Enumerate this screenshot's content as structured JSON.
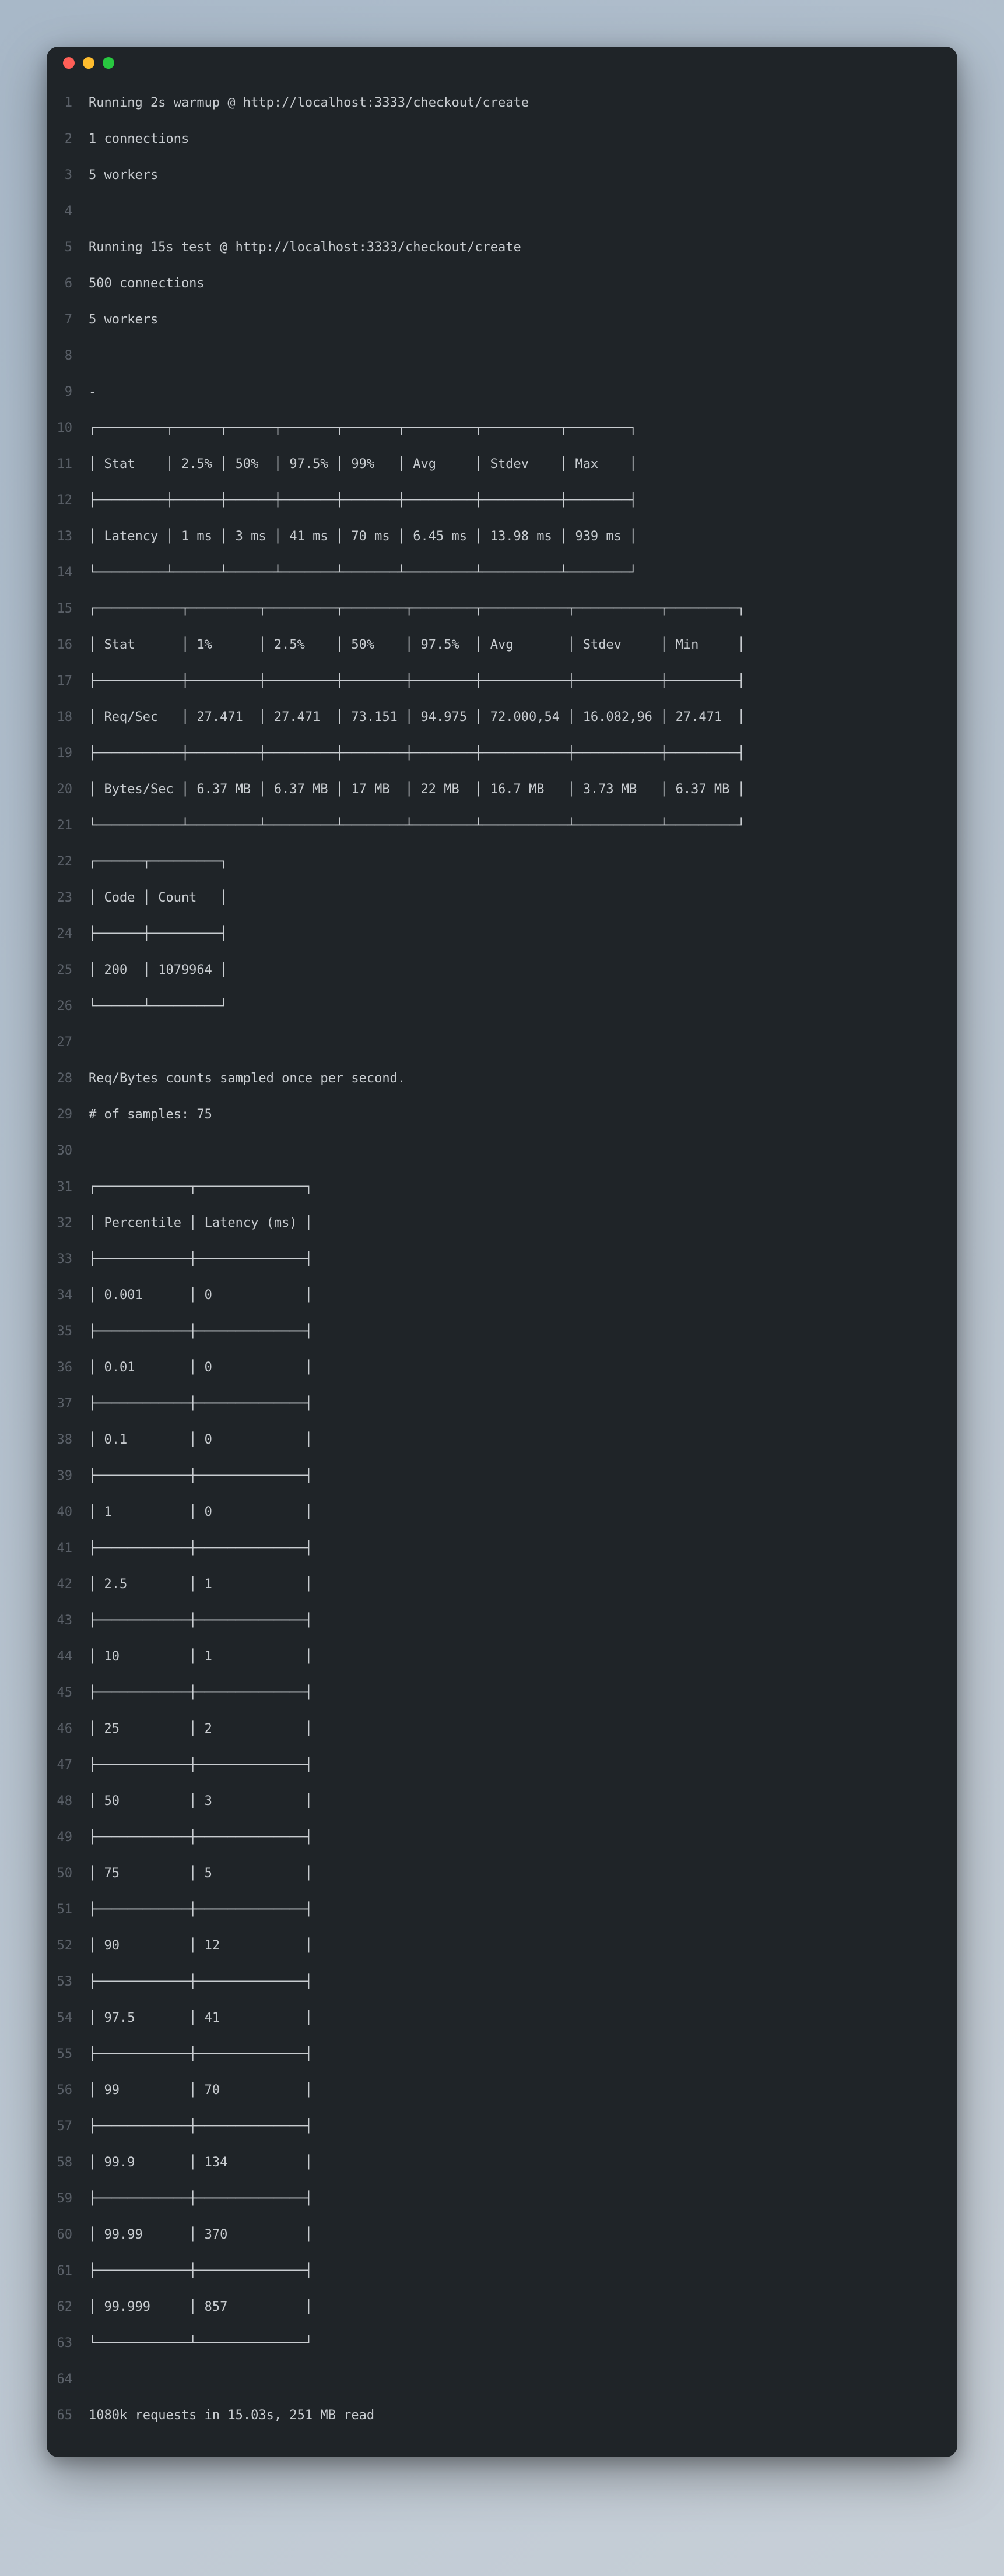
{
  "lines": [
    "Running 2s warmup @ http://localhost:3333/checkout/create",
    "1 connections",
    "5 workers",
    "",
    "Running 15s test @ http://localhost:3333/checkout/create",
    "500 connections",
    "5 workers",
    "",
    "-",
    "┌─────────┬──────┬──────┬───────┬───────┬─────────┬──────────┬────────┐",
    "│ Stat    │ 2.5% │ 50%  │ 97.5% │ 99%   │ Avg     │ Stdev    │ Max    │",
    "├─────────┼──────┼──────┼───────┼───────┼─────────┼──────────┼────────┤",
    "│ Latency │ 1 ms │ 3 ms │ 41 ms │ 70 ms │ 6.45 ms │ 13.98 ms │ 939 ms │",
    "└─────────┴──────┴──────┴───────┴───────┴─────────┴──────────┴────────┘",
    "┌───────────┬─────────┬─────────┬────────┬────────┬───────────┬───────────┬─────────┐",
    "│ Stat      │ 1%      │ 2.5%    │ 50%    │ 97.5%  │ Avg       │ Stdev     │ Min     │",
    "├───────────┼─────────┼─────────┼────────┼────────┼───────────┼───────────┼─────────┤",
    "│ Req/Sec   │ 27.471  │ 27.471  │ 73.151 │ 94.975 │ 72.000,54 │ 16.082,96 │ 27.471  │",
    "├───────────┼─────────┼─────────┼────────┼────────┼───────────┼───────────┼─────────┤",
    "│ Bytes/Sec │ 6.37 MB │ 6.37 MB │ 17 MB  │ 22 MB  │ 16.7 MB   │ 3.73 MB   │ 6.37 MB │",
    "└───────────┴─────────┴─────────┴────────┴────────┴───────────┴───────────┴─────────┘",
    "┌──────┬─────────┐",
    "│ Code │ Count   │",
    "├──────┼─────────┤",
    "│ 200  │ 1079964 │",
    "└──────┴─────────┘",
    "",
    "Req/Bytes counts sampled once per second.",
    "# of samples: 75",
    "",
    "┌────────────┬──────────────┐",
    "│ Percentile │ Latency (ms) │",
    "├────────────┼──────────────┤",
    "│ 0.001      │ 0            │",
    "├────────────┼──────────────┤",
    "│ 0.01       │ 0            │",
    "├────────────┼──────────────┤",
    "│ 0.1        │ 0            │",
    "├────────────┼──────────────┤",
    "│ 1          │ 0            │",
    "├────────────┼──────────────┤",
    "│ 2.5        │ 1            │",
    "├────────────┼──────────────┤",
    "│ 10         │ 1            │",
    "├────────────┼──────────────┤",
    "│ 25         │ 2            │",
    "├────────────┼──────────────┤",
    "│ 50         │ 3            │",
    "├────────────┼──────────────┤",
    "│ 75         │ 5            │",
    "├────────────┼──────────────┤",
    "│ 90         │ 12           │",
    "├────────────┼──────────────┤",
    "│ 97.5       │ 41           │",
    "├────────────┼──────────────┤",
    "│ 99         │ 70           │",
    "├────────────┼──────────────┤",
    "│ 99.9       │ 134          │",
    "├────────────┼──────────────┤",
    "│ 99.99      │ 370          │",
    "├────────────┼──────────────┤",
    "│ 99.999     │ 857          │",
    "└────────────┴──────────────┘",
    "",
    "1080k requests in 15.03s, 251 MB read"
  ],
  "chart_data": [
    {
      "type": "table",
      "title": "Latency statistics",
      "columns": [
        "Stat",
        "2.5%",
        "50%",
        "97.5%",
        "99%",
        "Avg",
        "Stdev",
        "Max"
      ],
      "rows": [
        [
          "Latency",
          "1 ms",
          "3 ms",
          "41 ms",
          "70 ms",
          "6.45 ms",
          "13.98 ms",
          "939 ms"
        ]
      ]
    },
    {
      "type": "table",
      "title": "Throughput statistics",
      "columns": [
        "Stat",
        "1%",
        "2.5%",
        "50%",
        "97.5%",
        "Avg",
        "Stdev",
        "Min"
      ],
      "rows": [
        [
          "Req/Sec",
          "27.471",
          "27.471",
          "73.151",
          "94.975",
          "72.000,54",
          "16.082,96",
          "27.471"
        ],
        [
          "Bytes/Sec",
          "6.37 MB",
          "6.37 MB",
          "17 MB",
          "22 MB",
          "16.7 MB",
          "3.73 MB",
          "6.37 MB"
        ]
      ]
    },
    {
      "type": "table",
      "title": "Status codes",
      "columns": [
        "Code",
        "Count"
      ],
      "rows": [
        [
          "200",
          "1079964"
        ]
      ]
    },
    {
      "type": "table",
      "title": "Latency percentiles",
      "columns": [
        "Percentile",
        "Latency (ms)"
      ],
      "rows": [
        [
          "0.001",
          0
        ],
        [
          "0.01",
          0
        ],
        [
          "0.1",
          0
        ],
        [
          "1",
          0
        ],
        [
          "2.5",
          1
        ],
        [
          "10",
          1
        ],
        [
          "25",
          2
        ],
        [
          "50",
          3
        ],
        [
          "75",
          5
        ],
        [
          "90",
          12
        ],
        [
          "97.5",
          41
        ],
        [
          "99",
          70
        ],
        [
          "99.9",
          134
        ],
        [
          "99.99",
          370
        ],
        [
          "99.999",
          857
        ]
      ]
    }
  ],
  "meta": {
    "warmup": {
      "duration": "2s",
      "url": "http://localhost:3333/checkout/create",
      "connections": 1,
      "workers": 5
    },
    "test": {
      "duration": "15s",
      "url": "http://localhost:3333/checkout/create",
      "connections": 500,
      "workers": 5
    },
    "sampling_note": "Req/Bytes counts sampled once per second.",
    "samples": 75,
    "summary": "1080k requests in 15.03s, 251 MB read"
  }
}
